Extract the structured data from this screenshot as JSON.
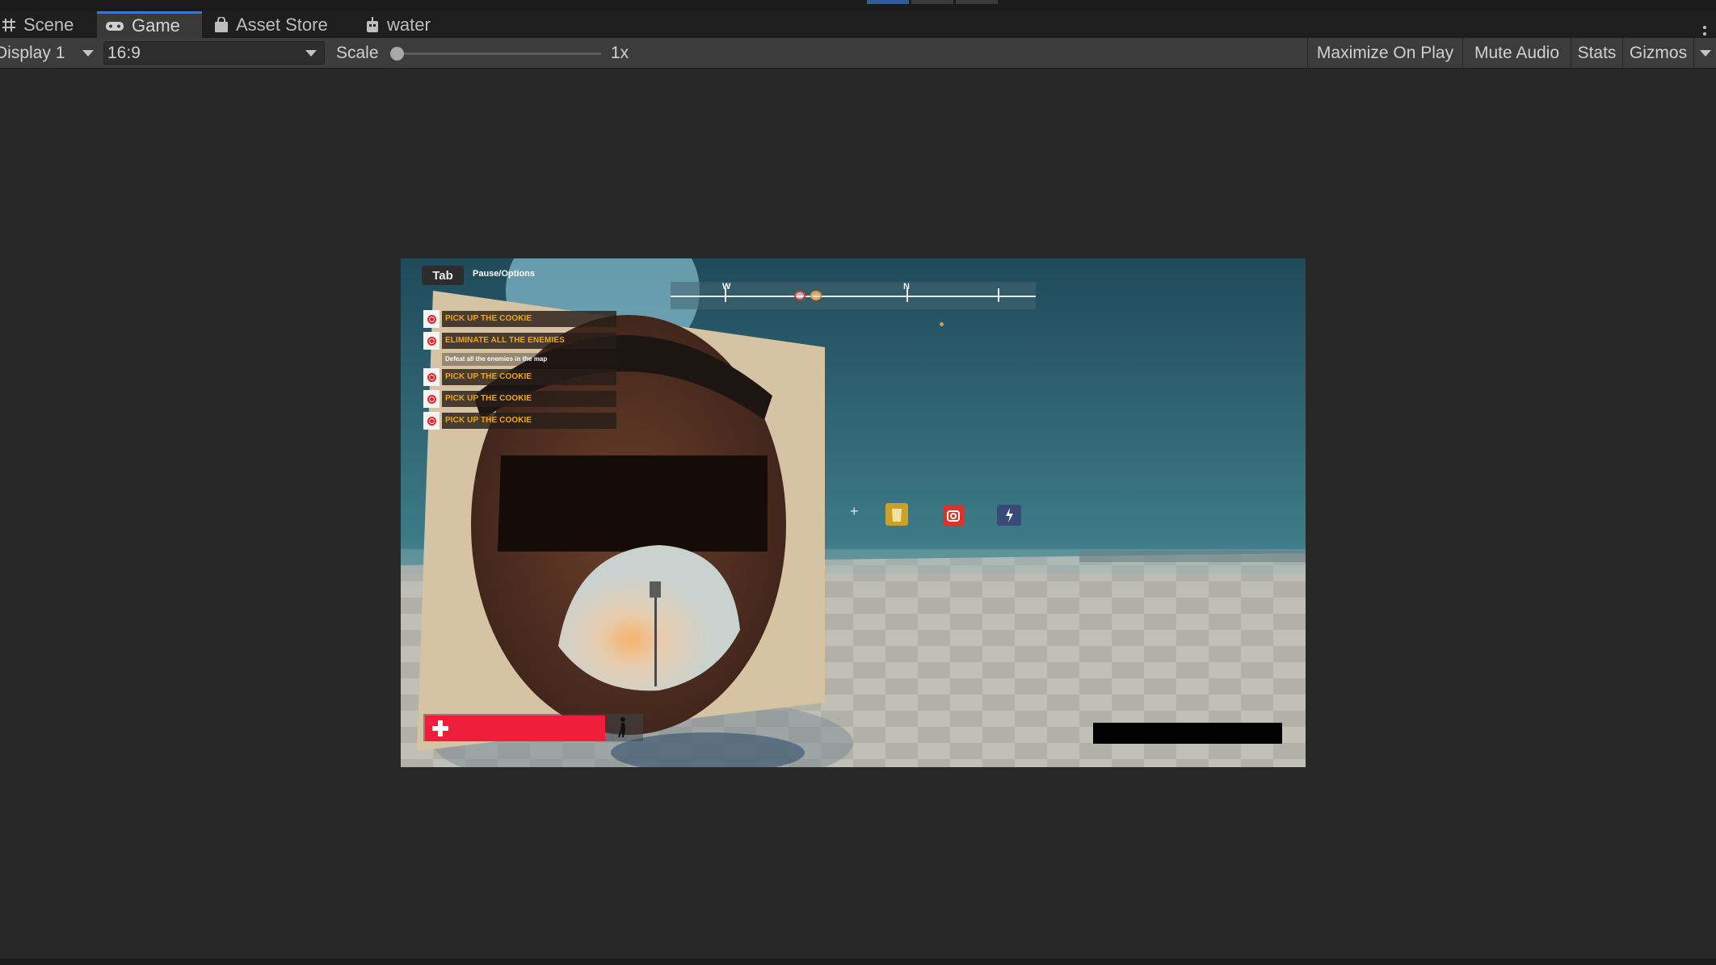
{
  "tabs": [
    {
      "label": "Scene",
      "icon": "grid-icon"
    },
    {
      "label": "Game",
      "icon": "gamepad-icon",
      "active": true
    },
    {
      "label": "Asset Store",
      "icon": "shopping-bag-icon"
    },
    {
      "label": "water",
      "icon": "robot-icon"
    }
  ],
  "toolbar": {
    "display": "Display 1",
    "aspect": "16:9",
    "scale_label": "Scale",
    "scale_value": "1x",
    "maximize": "Maximize On Play",
    "mute": "Mute Audio",
    "stats": "Stats",
    "gizmos": "Gizmos"
  },
  "game": {
    "tab_key": "Tab",
    "tab_action": "Pause/Options",
    "compass": {
      "w": "W",
      "n": "N"
    },
    "objectives": [
      {
        "label": "PICK UP THE COOKIE"
      },
      {
        "label": "ELIMINATE ALL THE ENEMIES",
        "desc": "Defeat all the enemies in the map"
      },
      {
        "label": "PICK UP THE COOKIE"
      },
      {
        "label": "PICK UP THE COOKIE"
      },
      {
        "label": "PICK UP THE COOKIE"
      }
    ],
    "crosshair": "+",
    "abilities": [
      {
        "icon": "cookie-jar-icon",
        "color": "#c9a227"
      },
      {
        "icon": "camera-icon",
        "color": "#d8332d"
      },
      {
        "icon": "lightning-icon",
        "color": "#3a4a78"
      }
    ],
    "health_fraction": 0.82,
    "colors": {
      "health": "#ef1f3c",
      "objective_text": "#f2a516",
      "accent_tab": "#3b78c4"
    }
  }
}
